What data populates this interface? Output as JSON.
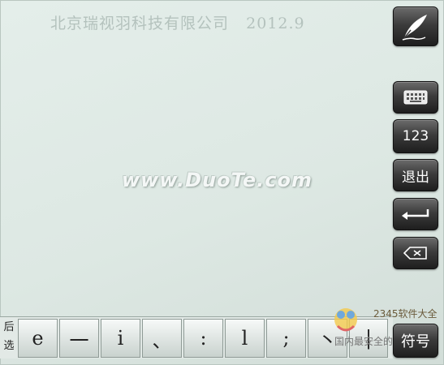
{
  "header": {
    "company": "北京瑞视羽科技有限公司",
    "version": "2012.9"
  },
  "watermark": "www.DuoTe.com",
  "side_buttons": {
    "pen_icon": "handwriting-pen-icon",
    "keyboard_icon": "keyboard-icon",
    "numbers_label": "123",
    "exit_label": "退出",
    "enter_icon": "enter-arrow-icon",
    "backspace_icon": "backspace-icon",
    "symbols_label": "符号"
  },
  "candidate_bar": {
    "back_label": "后",
    "select_label": "选",
    "items": [
      {
        "text": "e"
      },
      {
        "text": "一"
      },
      {
        "text": "i"
      },
      {
        "text": "、"
      },
      {
        "text": ":"
      },
      {
        "text": "l"
      },
      {
        "text": ";"
      },
      {
        "text": "丶"
      },
      {
        "text": "|"
      }
    ]
  },
  "overlay_logo": {
    "brand": "2345软件大全",
    "slogan": "国内最安全的软件站"
  },
  "colors": {
    "button_dark": "#3c3c3c",
    "background": "#e0ebe6"
  }
}
